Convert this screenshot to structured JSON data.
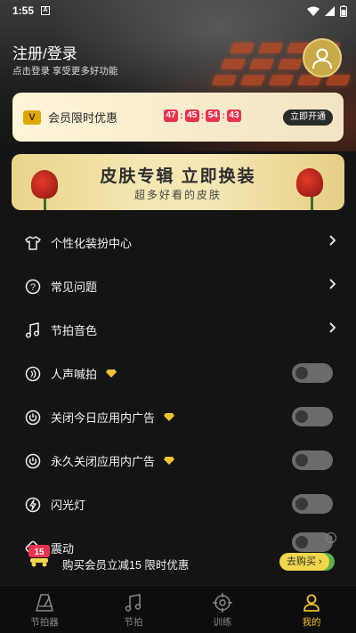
{
  "status": {
    "time": "1:55"
  },
  "header": {
    "login_title": "注册/登录",
    "login_subtitle": "点击登录 享受更多好功能"
  },
  "vip": {
    "badge": "V",
    "title": "会员限时优惠",
    "countdown": [
      "47",
      "45",
      "54",
      "43"
    ],
    "button": "立即开通",
    "accent": "#e8334e"
  },
  "skin_banner": {
    "title": "皮肤专辑  立即换装",
    "subtitle": "超多好看的皮肤"
  },
  "menu": {
    "items": [
      {
        "label": "个性化装扮中心",
        "icon": "shirt-icon",
        "control": "chevron"
      },
      {
        "label": "常见问题",
        "icon": "question-icon",
        "control": "chevron"
      },
      {
        "label": "节拍音色",
        "icon": "music-note-icon",
        "control": "chevron"
      },
      {
        "label": "人声喊拍",
        "icon": "voice-icon",
        "control": "toggle",
        "premium": true
      },
      {
        "label": "关闭今日应用内广告",
        "icon": "power-icon",
        "control": "toggle",
        "premium": true
      },
      {
        "label": "永久关闭应用内广告",
        "icon": "power-icon",
        "control": "toggle",
        "premium": true
      },
      {
        "label": "闪光灯",
        "icon": "flash-icon",
        "control": "toggle"
      },
      {
        "label": "震动",
        "icon": "vibrate-icon",
        "control": "toggle"
      }
    ]
  },
  "promo": {
    "badge": "15",
    "text": "购买会员立减15   限时优惠",
    "button": "去购买 ›"
  },
  "tabs": [
    {
      "label": "节拍器",
      "icon": "metronome-icon",
      "active": false
    },
    {
      "label": "节拍",
      "icon": "music-note-icon",
      "active": false
    },
    {
      "label": "训练",
      "icon": "target-icon",
      "active": false
    },
    {
      "label": "我的",
      "icon": "person-icon",
      "active": true
    }
  ],
  "colors": {
    "gold": "#f2c230",
    "background": "#141414"
  }
}
